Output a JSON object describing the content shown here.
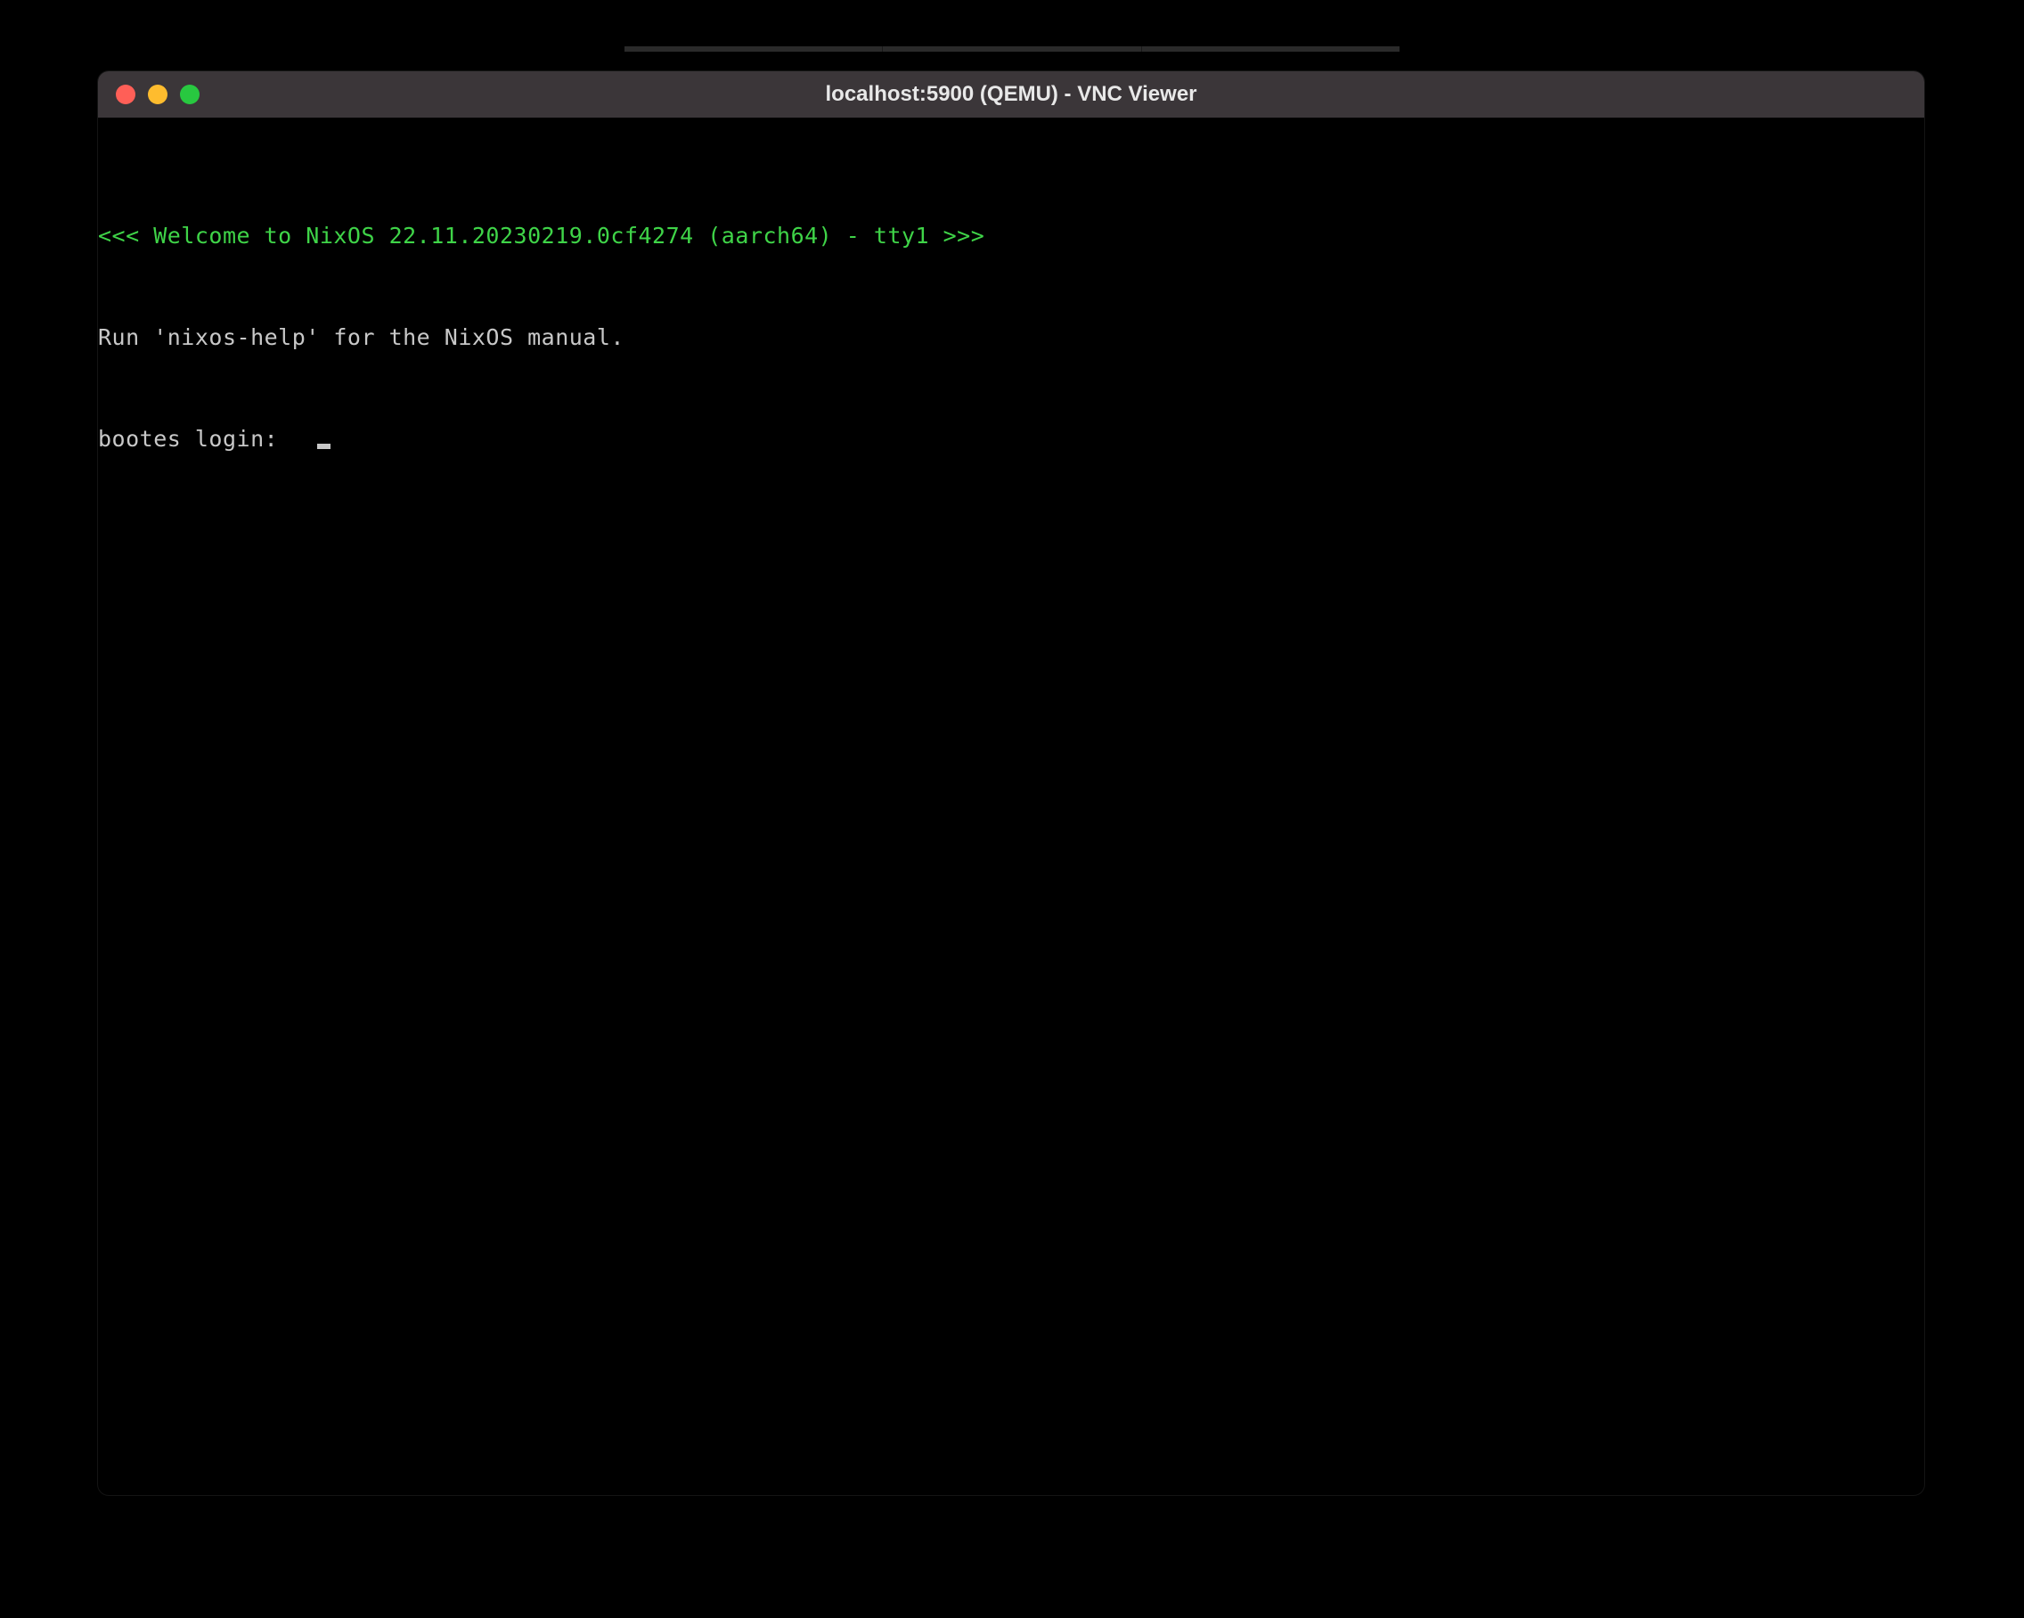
{
  "window": {
    "title": "localhost:5900 (QEMU) - VNC Viewer"
  },
  "terminal": {
    "welcome": "<<< Welcome to NixOS 22.11.20230219.0cf4274 (aarch64) - tty1 >>>",
    "help": "Run 'nixos-help' for the NixOS manual.",
    "login_prompt": "bootes login: "
  },
  "colors": {
    "welcome_green": "#3fd448",
    "text": "#c8c8c8",
    "titlebar": "#3b3639"
  }
}
